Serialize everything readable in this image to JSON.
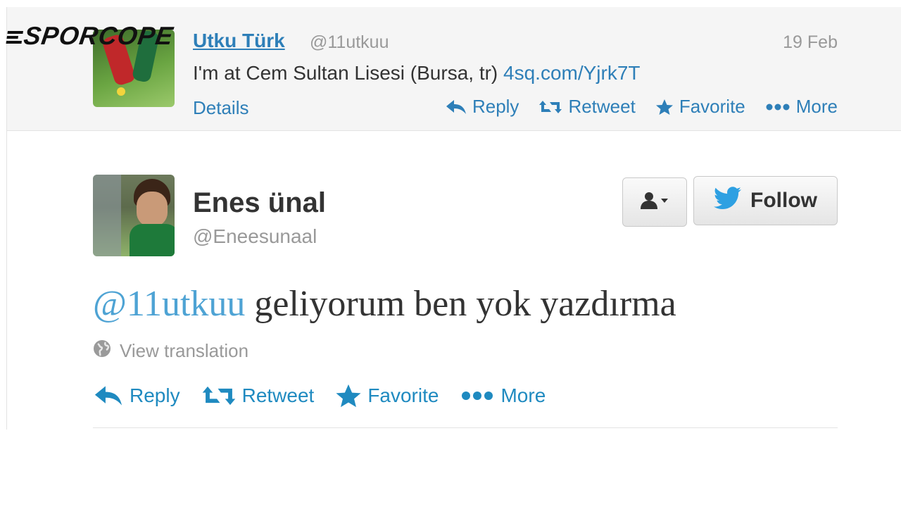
{
  "watermark": {
    "text": "SPORCOPE"
  },
  "context_tweet": {
    "author_name": "Utku Türk",
    "author_handle": "@11utkuu",
    "date": "19 Feb",
    "text": "I'm at Cem Sultan Lisesi (Bursa, tr) ",
    "link": "4sq.com/Yjrk7T",
    "details_label": "Details",
    "actions": {
      "reply": "Reply",
      "retweet": "Retweet",
      "favorite": "Favorite",
      "more": "More"
    }
  },
  "main_tweet": {
    "author_name": "Enes ünal",
    "author_handle": "@Eneesunaal",
    "follow_label": "Follow",
    "mention": "@11utkuu",
    "text": " geliyorum ben yok yazdırma",
    "view_translation": "View translation",
    "actions": {
      "reply": "Reply",
      "retweet": "Retweet",
      "favorite": "Favorite",
      "more": "More"
    }
  },
  "colors": {
    "link": "#2e7fb8",
    "action": "#1f8ac0",
    "muted": "#999999",
    "context_bg": "#f5f5f5"
  },
  "icons": [
    "reply-icon",
    "retweet-icon",
    "favorite-icon",
    "more-icon",
    "globe-icon",
    "user-dropdown-icon",
    "twitter-bird-icon"
  ]
}
